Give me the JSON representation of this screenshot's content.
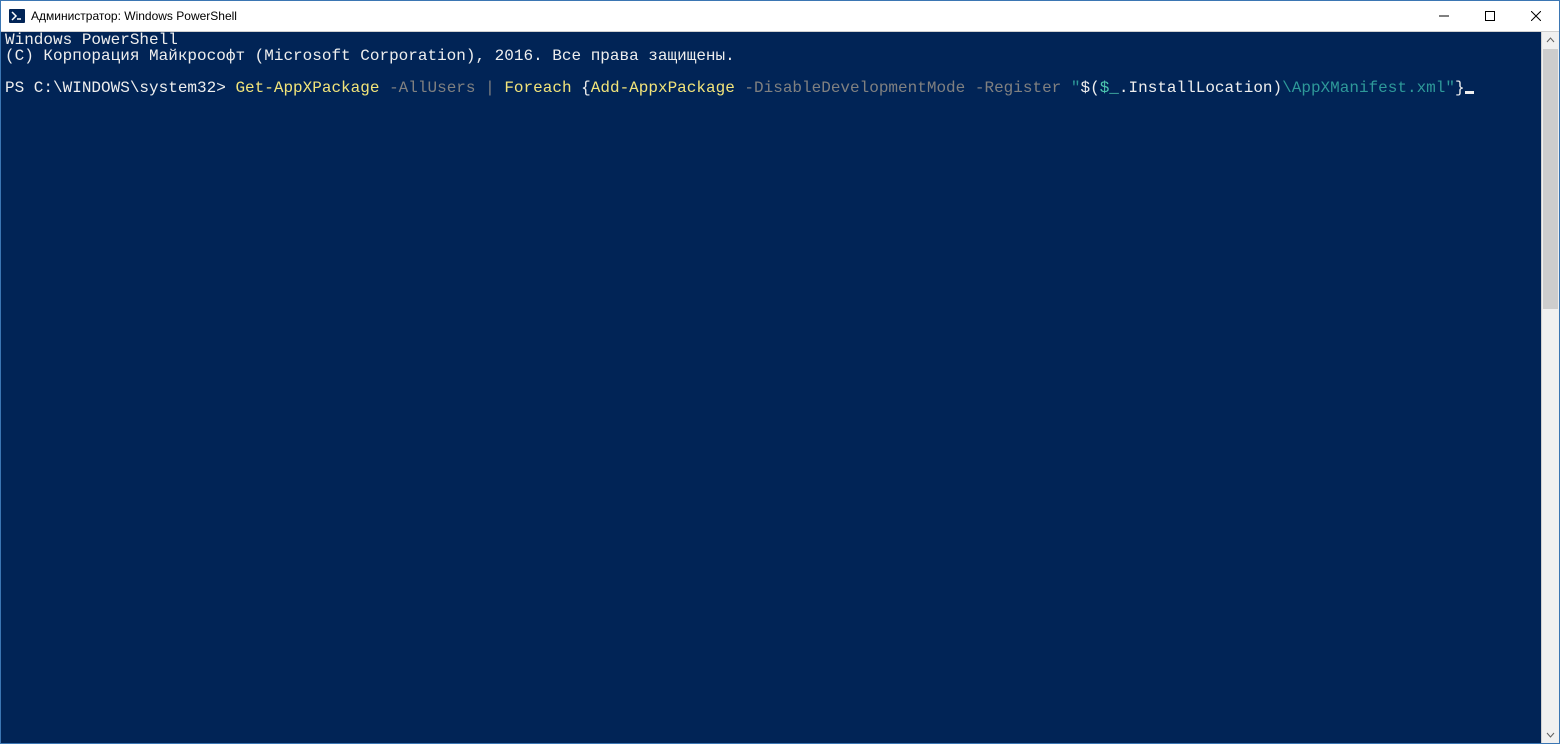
{
  "window": {
    "title": "Администратор: Windows PowerShell"
  },
  "terminal": {
    "header_line1": "Windows PowerShell",
    "header_line2": "(C) Корпорация Майкрософт (Microsoft Corporation), 2016. Все права защищены.",
    "prompt": "PS C:\\WINDOWS\\system32> ",
    "cmd": {
      "t1": "Get-AppXPackage",
      "sp1": " ",
      "t2": "-AllUsers",
      "sp2": " ",
      "t3": "|",
      "sp3": " ",
      "t4": "Foreach",
      "sp4": " ",
      "t5": "{",
      "t6": "Add-AppxPackage",
      "sp5": " ",
      "t7": "-DisableDevelopmentMode",
      "sp6": " ",
      "t8": "-Register",
      "sp7": " ",
      "t9": "\"",
      "t10": "$(",
      "t11": "$_",
      "t12": ".InstallLocation)",
      "t13": "\\AppXManifest.xml",
      "t14": "\"",
      "t15": "}"
    }
  }
}
